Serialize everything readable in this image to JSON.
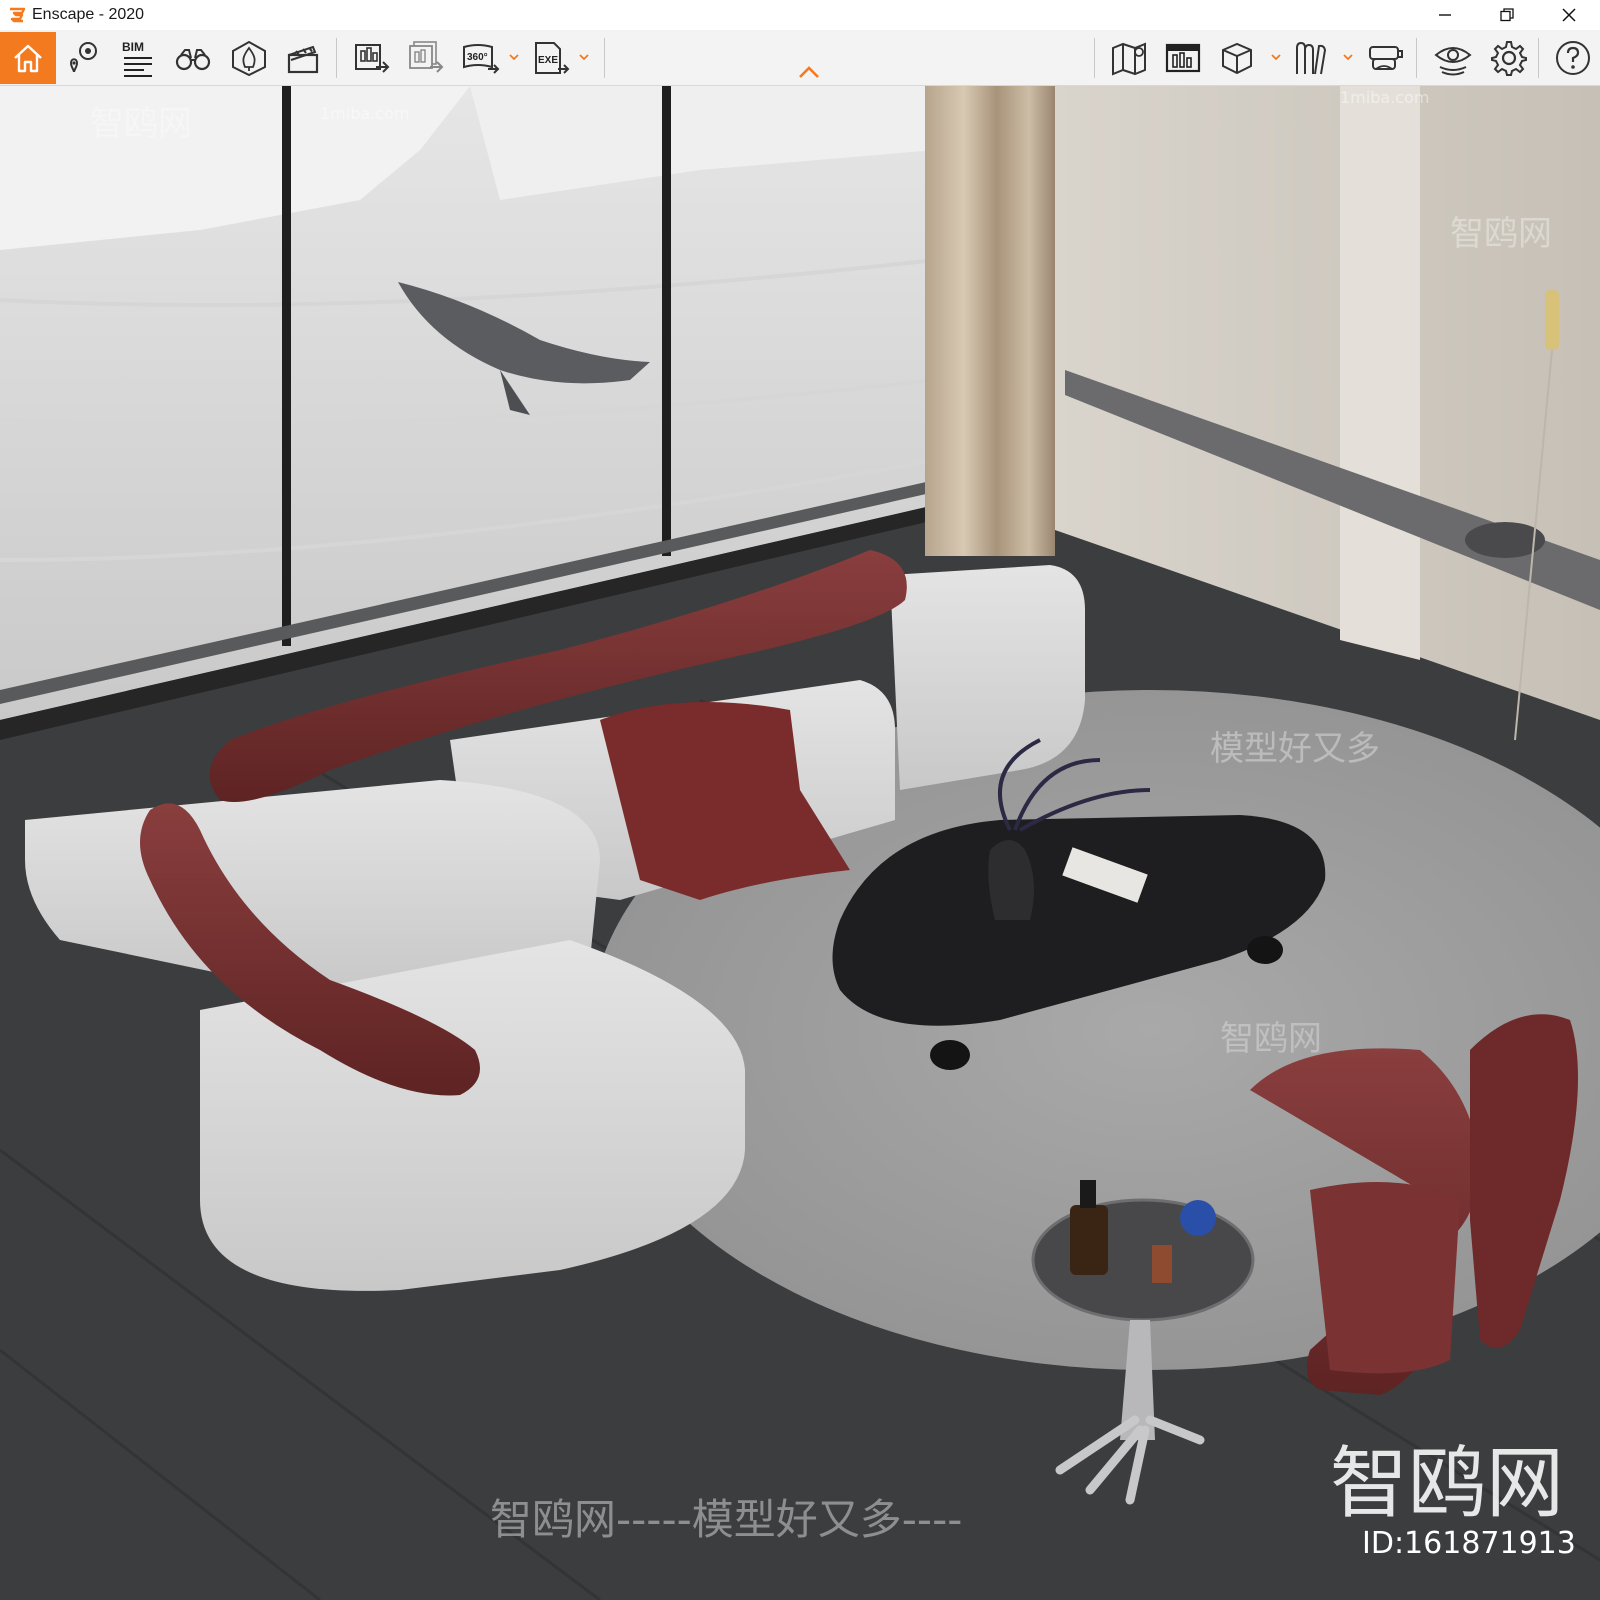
{
  "window": {
    "title": "Enscape - 2020",
    "controls": [
      "minimize",
      "restore",
      "close"
    ]
  },
  "toolbar": {
    "left_tools": [
      {
        "name": "home",
        "icon": "home-icon",
        "active": true
      },
      {
        "name": "asset-library",
        "icon": "asset-library-icon"
      },
      {
        "name": "bim-info",
        "icon": "bim-icon",
        "label": "BIM"
      },
      {
        "name": "views",
        "icon": "binoculars-icon"
      },
      {
        "name": "atmosphere",
        "icon": "atmosphere-icon"
      },
      {
        "name": "video-editor",
        "icon": "clapperboard-icon"
      },
      {
        "name": "render-image",
        "icon": "render-image-icon"
      },
      {
        "name": "batch-render",
        "icon": "batch-render-icon"
      },
      {
        "name": "panorama",
        "icon": "panorama-360-icon",
        "label": "360°"
      },
      {
        "name": "export-exe",
        "icon": "export-exe-icon",
        "label": "EXE"
      }
    ],
    "right_tools": [
      {
        "name": "map",
        "icon": "map-icon"
      },
      {
        "name": "visual-settings",
        "icon": "visual-settings-icon"
      },
      {
        "name": "objects",
        "icon": "cube-icon"
      },
      {
        "name": "books",
        "icon": "books-icon"
      },
      {
        "name": "vr-headset",
        "icon": "vr-headset-icon"
      },
      {
        "name": "view-mode",
        "icon": "eye-icon"
      },
      {
        "name": "settings",
        "icon": "gear-icon"
      },
      {
        "name": "help",
        "icon": "help-icon"
      }
    ],
    "accent": "#f47a20"
  },
  "viewport": {
    "watermarks": {
      "brand_small": "1miba.com",
      "brand_cn": "智鸥网",
      "slogan": "模型好又多",
      "footer_slogan": "智鸥网-----模型好又多----",
      "corner_brand": "智鸥网",
      "id_label": "ID:161871913"
    }
  }
}
